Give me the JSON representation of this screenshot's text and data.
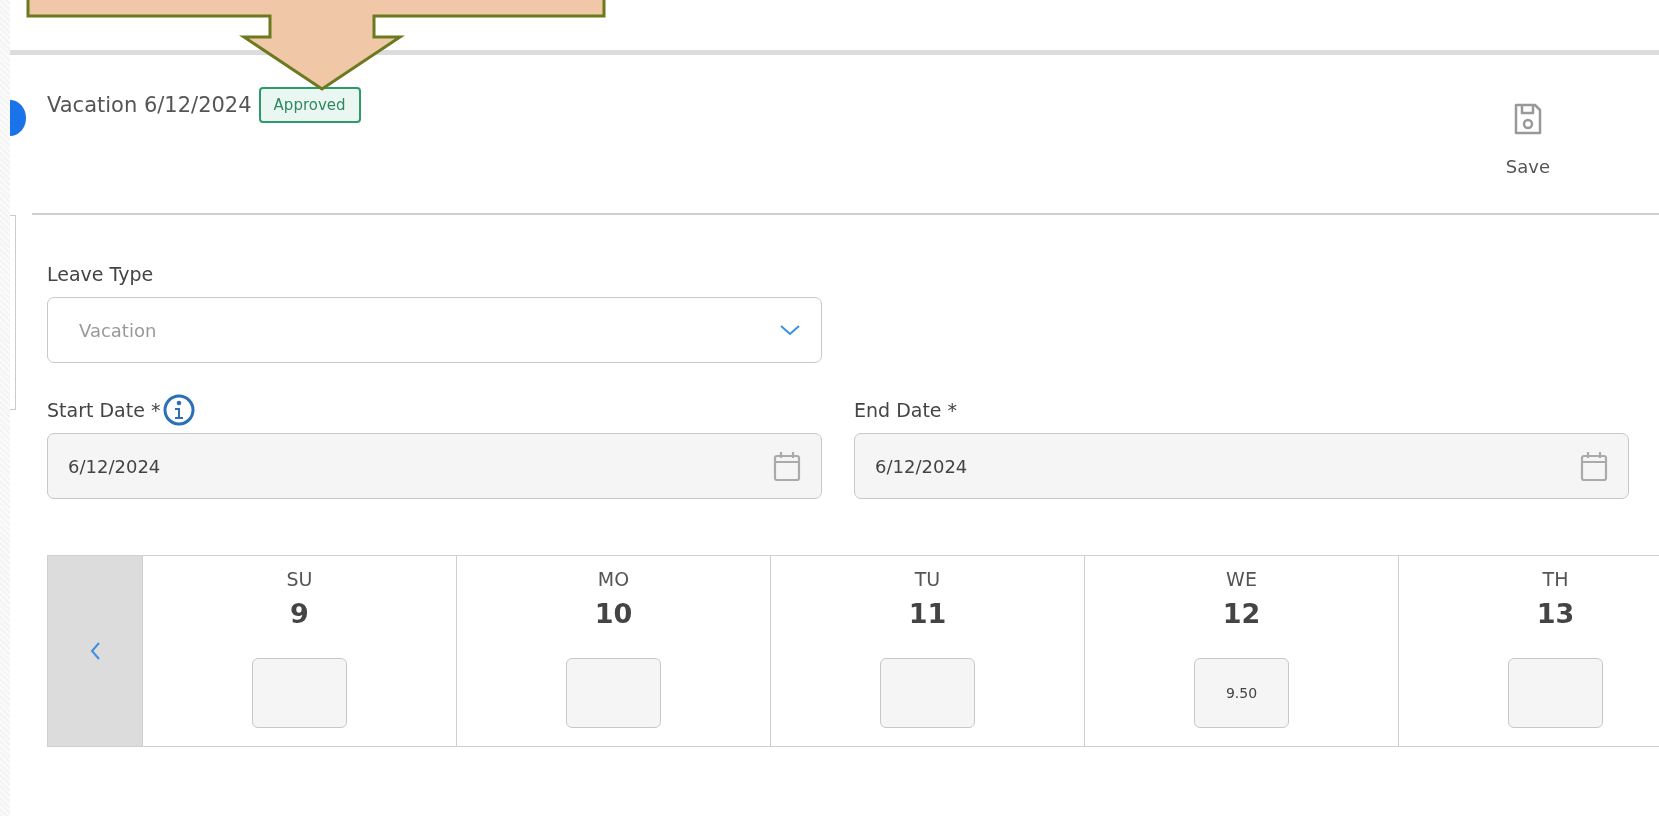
{
  "request": {
    "title": "Vacation 6/12/2024",
    "status": "Approved"
  },
  "toolbar": {
    "save_label": "Save"
  },
  "leave_type": {
    "label": "Leave Type",
    "value": "Vacation"
  },
  "start_date": {
    "label": "Start Date *",
    "value": "6/12/2024"
  },
  "end_date": {
    "label": "End Date *",
    "value": "6/12/2024"
  },
  "days": [
    {
      "weekday": "SU",
      "date": "9"
    },
    {
      "weekday": "MO",
      "date": "10"
    },
    {
      "weekday": "TU",
      "date": "11"
    },
    {
      "weekday": "WE",
      "date": "12",
      "hours": "9.50"
    },
    {
      "weekday": "TH",
      "date": "13"
    }
  ]
}
